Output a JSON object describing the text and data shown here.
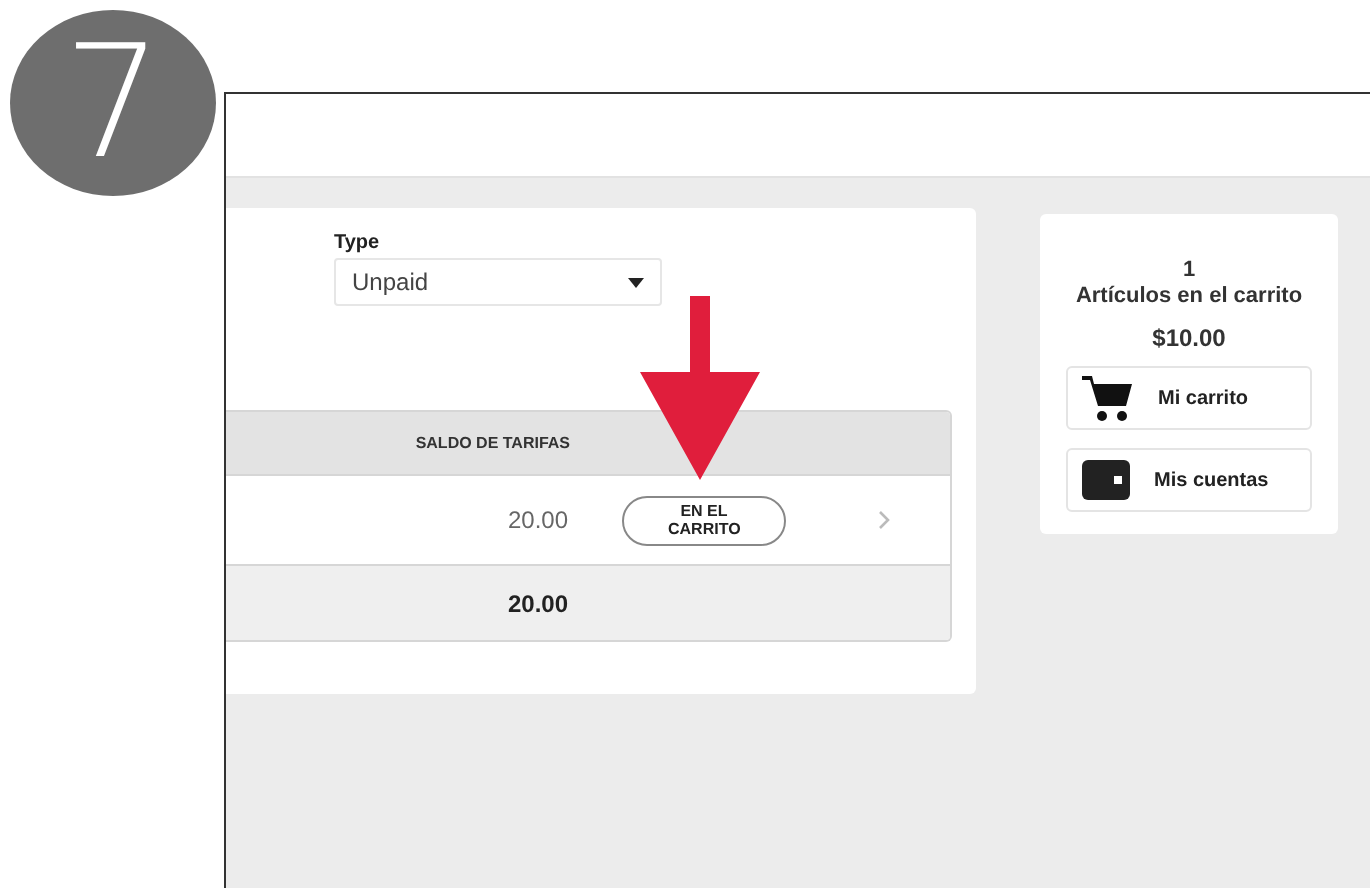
{
  "step_badge": "7",
  "filter": {
    "label": "Type",
    "value": "Unpaid"
  },
  "table": {
    "columns": [
      "SALDO DE TARIFAS"
    ],
    "rows": [
      {
        "amount": "20.00",
        "button": "EN EL CARRITO"
      }
    ],
    "total": "20.00"
  },
  "cart": {
    "count": "1",
    "label": "Artículos en el carrito",
    "amount": "$10.00",
    "buttons": [
      {
        "kind": "cart",
        "label": "Mi carrito"
      },
      {
        "kind": "wallet",
        "label": "Mis cuentas"
      }
    ]
  }
}
